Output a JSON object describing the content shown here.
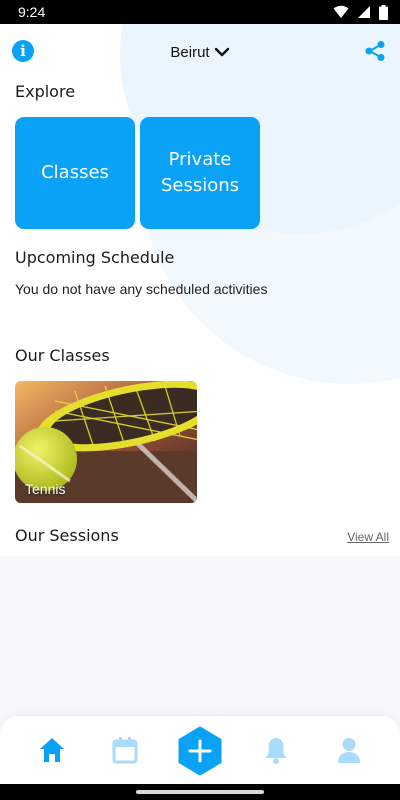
{
  "status_bar": {
    "time": "9:24"
  },
  "header": {
    "city": "Beirut"
  },
  "explore": {
    "title": "Explore",
    "tiles": [
      {
        "label": "Classes"
      },
      {
        "label": "Private\nSessions"
      }
    ]
  },
  "schedule": {
    "title": "Upcoming Schedule",
    "empty_text": "You do not have any scheduled activities"
  },
  "classes": {
    "title": "Our Classes",
    "items": [
      {
        "label": "Tennis"
      }
    ]
  },
  "sessions": {
    "title": "Our Sessions",
    "view_all": "View All"
  },
  "colors": {
    "accent": "#0aa2f7",
    "nav_inactive": "#a9dcfb"
  },
  "nav": {
    "items": [
      "home-icon",
      "calendar-icon",
      "add-icon",
      "bell-icon",
      "profile-icon"
    ]
  }
}
